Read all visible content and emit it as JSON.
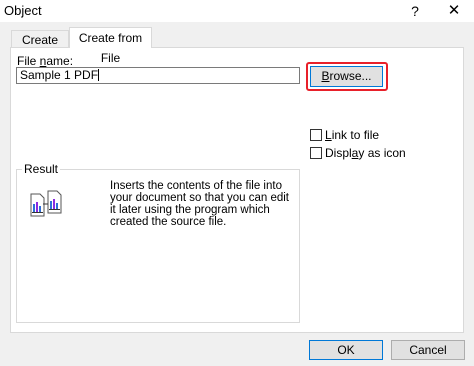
{
  "window": {
    "title": "Object",
    "help_label": "?",
    "close_label": "✕"
  },
  "tabs": [
    {
      "label": "Create New",
      "active": false
    },
    {
      "label": "Create from File",
      "active": true
    }
  ],
  "file": {
    "label_prefix": "File ",
    "label_underlined": "n",
    "label_suffix": "ame:",
    "value": "Sample 1 PDF",
    "browse_underlined": "B",
    "browse_rest": "rowse..."
  },
  "options": {
    "link_underlined": "L",
    "link_rest": "ink to file",
    "link_checked": false,
    "display_prefix": "Displ",
    "display_underlined": "a",
    "display_suffix": "y as icon",
    "display_checked": false
  },
  "result": {
    "legend": "Result",
    "icon": "embedded-documents-icon",
    "text": "Inserts the contents of the file into your document so that you can edit it later using the program which created the source file."
  },
  "buttons": {
    "ok": "OK",
    "cancel": "Cancel"
  },
  "colors": {
    "highlight": "#e8202a",
    "default_button_border": "#0078d7"
  }
}
